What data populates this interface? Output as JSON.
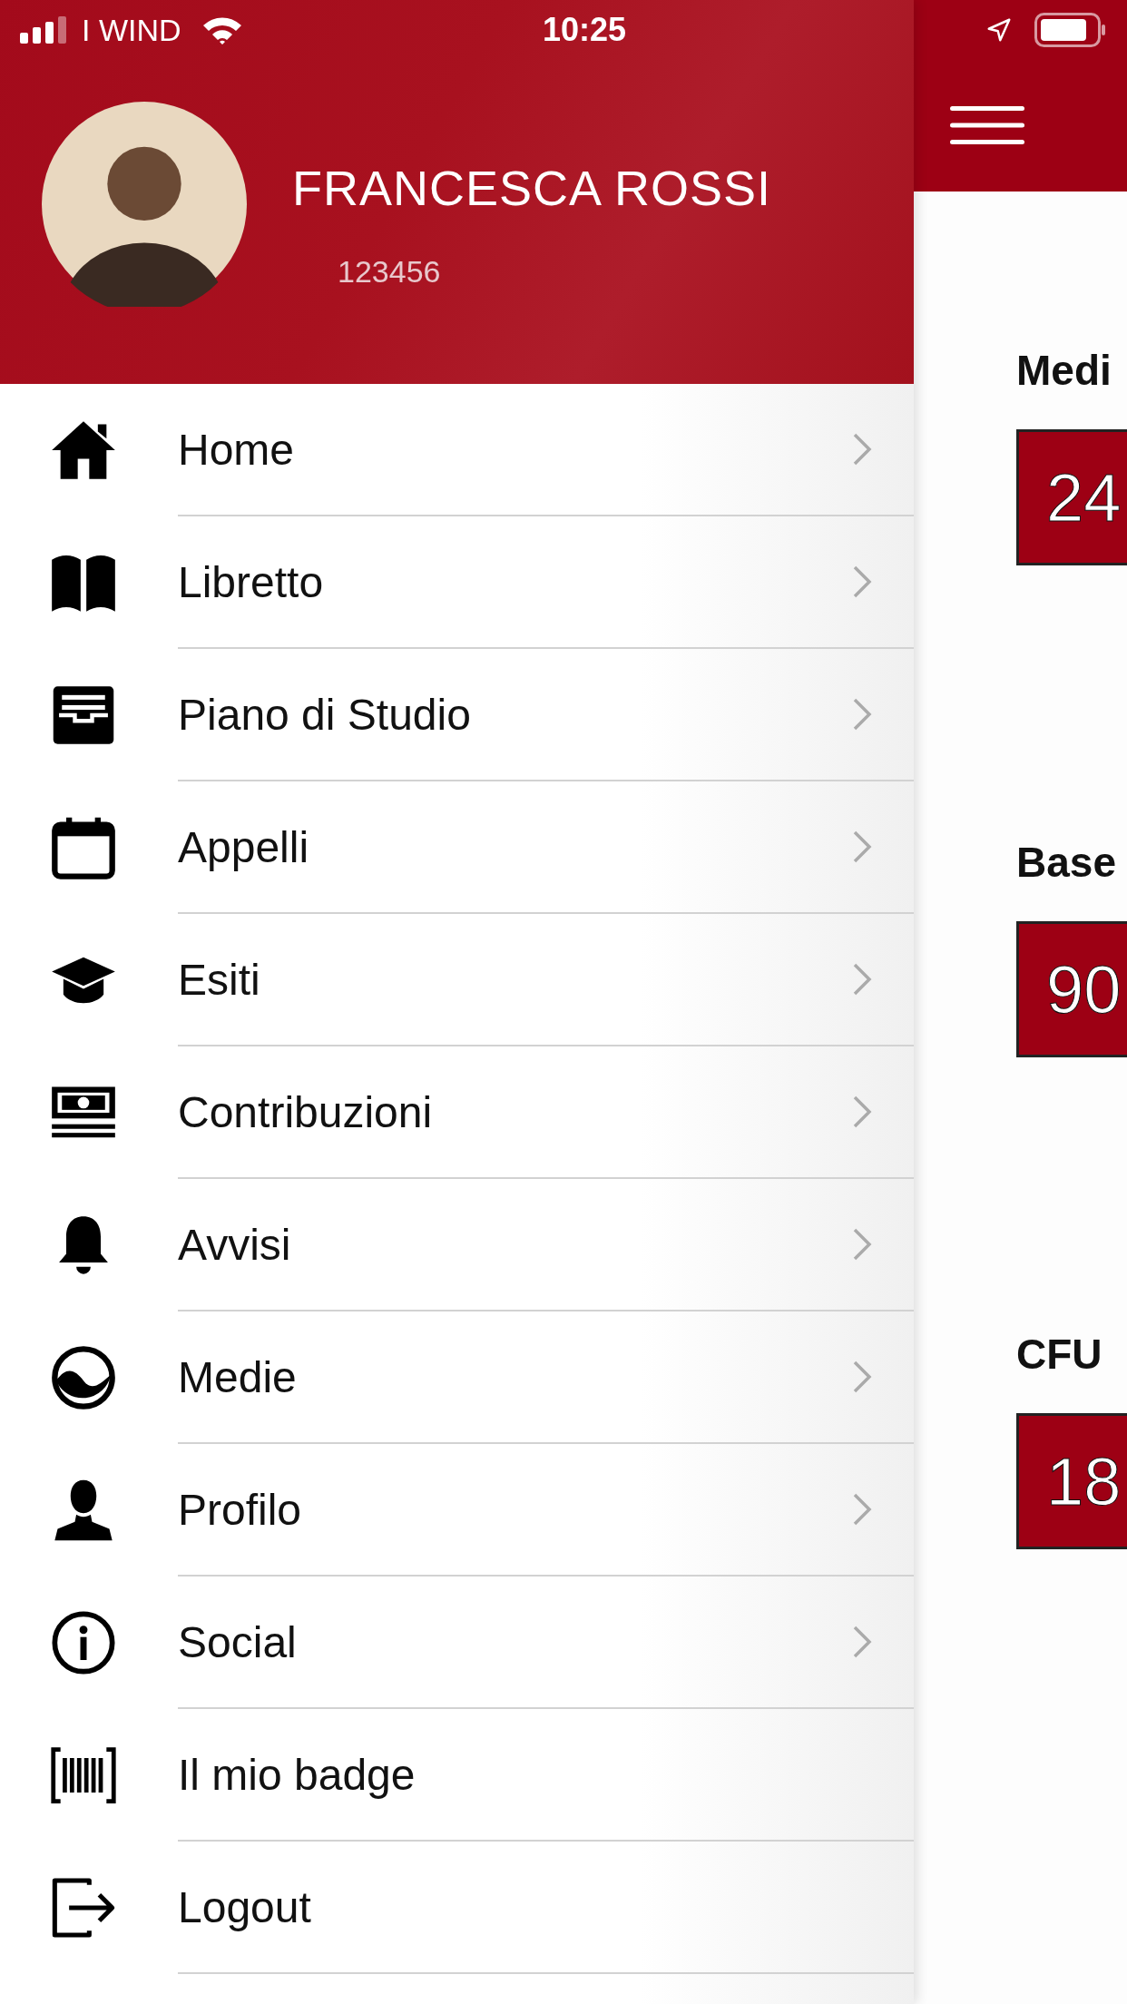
{
  "status_bar": {
    "carrier": "I WIND",
    "time": "10:25"
  },
  "profile": {
    "name": "FRANCESCA ROSSI",
    "id": "123456"
  },
  "menu": [
    {
      "label": "Home",
      "chevron": true
    },
    {
      "label": "Libretto",
      "chevron": true
    },
    {
      "label": "Piano di Studio",
      "chevron": true
    },
    {
      "label": "Appelli",
      "chevron": true
    },
    {
      "label": "Esiti",
      "chevron": true
    },
    {
      "label": "Contribuzioni",
      "chevron": true
    },
    {
      "label": "Avvisi",
      "chevron": true
    },
    {
      "label": "Medie",
      "chevron": true
    },
    {
      "label": "Profilo",
      "chevron": true
    },
    {
      "label": "Social",
      "chevron": true
    },
    {
      "label": "Il mio badge",
      "chevron": false
    },
    {
      "label": "Logout",
      "chevron": false
    }
  ],
  "stats": [
    {
      "label": "Medi",
      "value": "24"
    },
    {
      "label": "Base",
      "value": "90"
    },
    {
      "label": "CFU",
      "value": "18"
    }
  ]
}
